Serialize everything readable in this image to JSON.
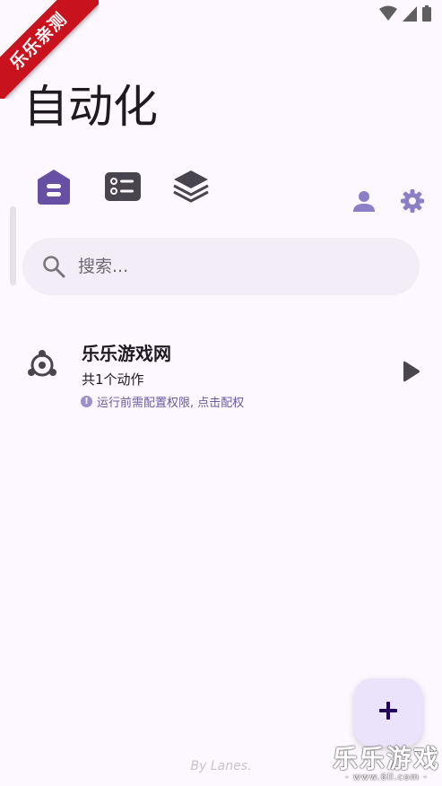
{
  "status_bar": {
    "icons": [
      "wifi-icon",
      "cell-signal-icon",
      "battery-icon"
    ]
  },
  "ribbon": {
    "label": "乐乐亲测"
  },
  "header": {
    "title": "自动化"
  },
  "tabs": [
    {
      "icon": "home-icon",
      "selected": true
    },
    {
      "icon": "list-icon",
      "selected": false
    },
    {
      "icon": "layers-icon",
      "selected": false
    }
  ],
  "header_actions": [
    {
      "icon": "person-icon"
    },
    {
      "icon": "gear-icon"
    }
  ],
  "search": {
    "placeholder": "搜索..."
  },
  "automations": [
    {
      "title": "乐乐游戏网",
      "subtitle": "共1个动作",
      "warning": "运行前需配置权限, 点击配权",
      "icon": "hub-icon"
    }
  ],
  "fab": {
    "label": "+"
  },
  "footer": {
    "credit": "By Lanes."
  },
  "watermark": {
    "title": "乐乐游戏",
    "url": "- www.6ll.com -"
  },
  "colors": {
    "background": "#FDF7FF",
    "accent": "#6750A4",
    "icon_muted": "#49454F",
    "action_icon": "#8B7FC6",
    "search_bg": "#F3EDF7",
    "fab_bg": "#EBE3FB",
    "ribbon": "#C8121E"
  }
}
